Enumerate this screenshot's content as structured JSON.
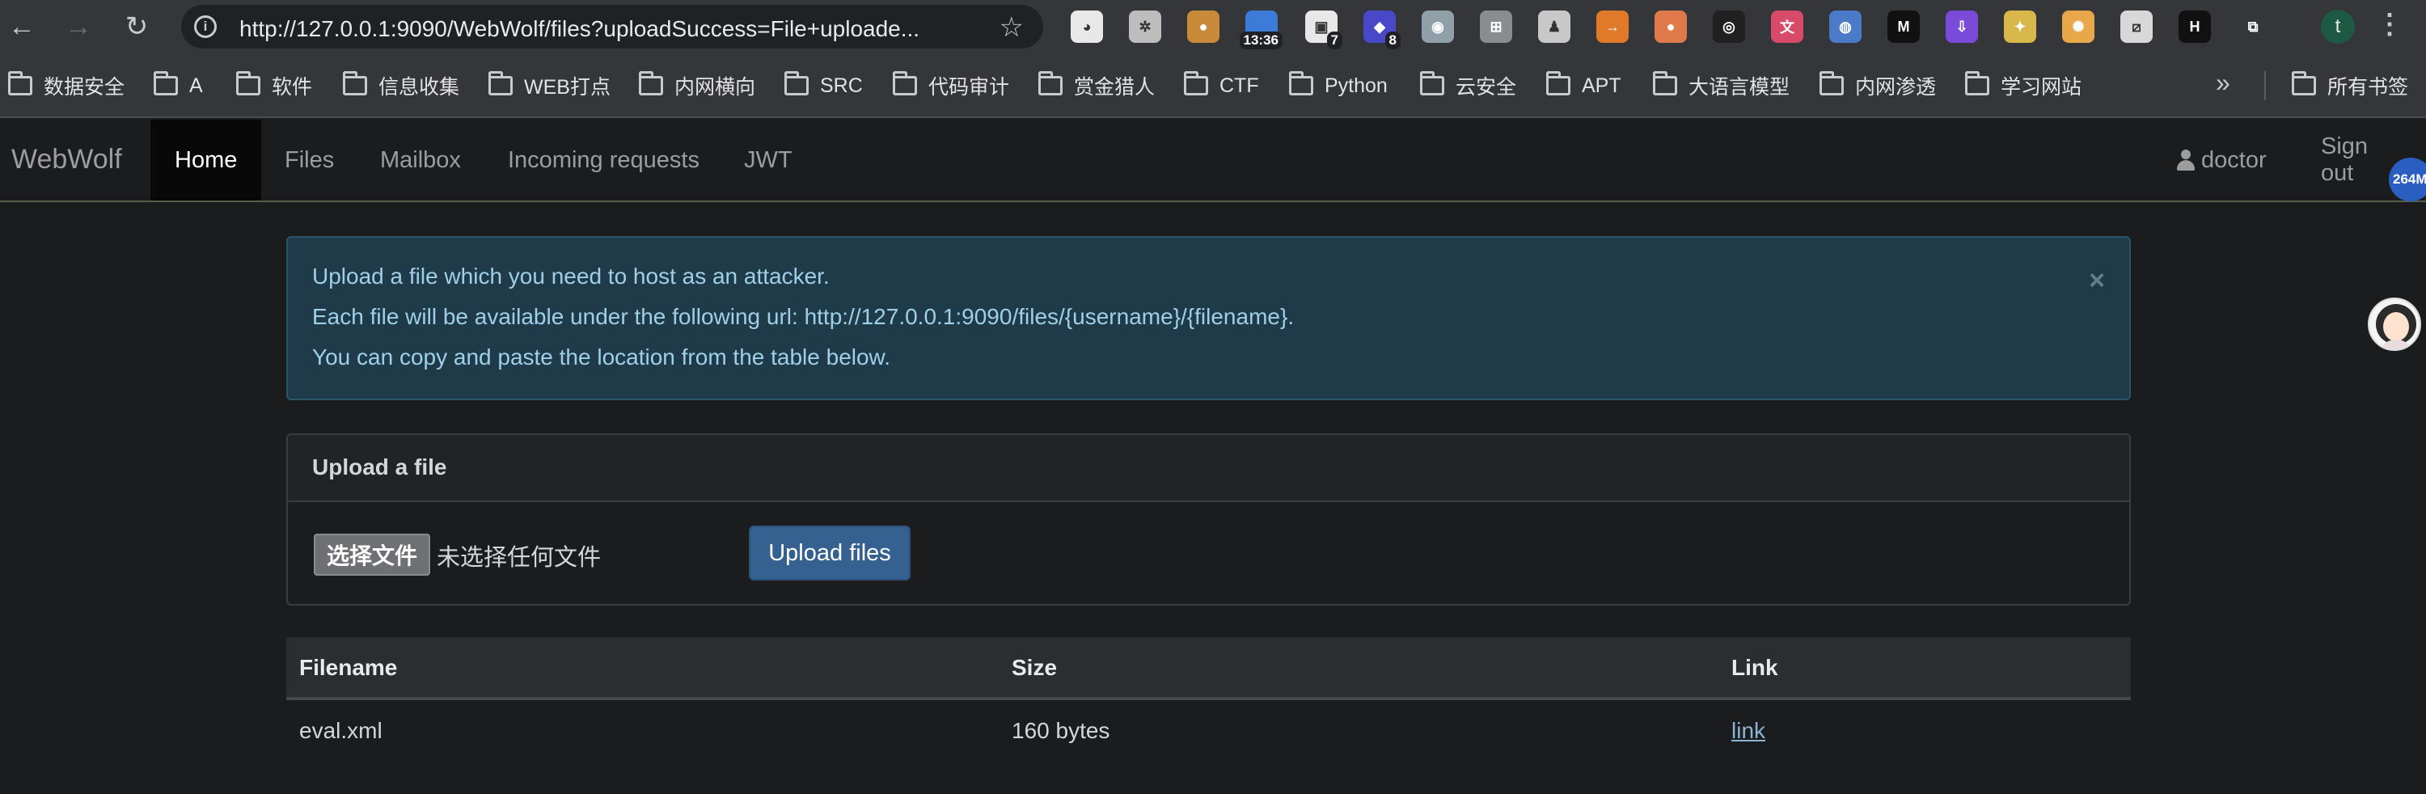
{
  "browser": {
    "url": "http://127.0.0.1:9090/WebWolf/files?uploadSuccess=File+uploade...",
    "extensions": [
      {
        "name": "ext-panda-icon",
        "color": "#e8e8e8",
        "glyph": "◕"
      },
      {
        "name": "ext-gear-icon",
        "color": "#bdbdbd",
        "glyph": "✲"
      },
      {
        "name": "ext-cookie-icon",
        "color": "#c98a3a",
        "glyph": "●"
      },
      {
        "name": "ext-clock-icon",
        "color": "#3d7bd9",
        "glyph": "",
        "badge": "13:36"
      },
      {
        "name": "ext-qr-icon",
        "color": "#e8e8e8",
        "glyph": "▣",
        "badge": "7"
      },
      {
        "name": "ext-cube-icon",
        "color": "#4848c8",
        "glyph": "◆",
        "badge": "8"
      },
      {
        "name": "ext-spy-icon",
        "color": "#8fa0a8",
        "glyph": "◉"
      },
      {
        "name": "ext-gitzip-icon",
        "color": "#8a8c90",
        "glyph": "⊞"
      },
      {
        "name": "ext-js-icon",
        "color": "#c8c8c8",
        "glyph": "♟"
      },
      {
        "name": "ext-arrow-icon",
        "color": "#e07a2a",
        "glyph": "→"
      },
      {
        "name": "ext-circle-icon",
        "color": "#e07a4a",
        "glyph": "●"
      },
      {
        "name": "ext-glasses-icon",
        "color": "#202020",
        "glyph": "◎"
      },
      {
        "name": "ext-translate-icon",
        "color": "#d84a6a",
        "glyph": "文"
      },
      {
        "name": "ext-drop-icon",
        "color": "#4a7ac8",
        "glyph": "◍"
      },
      {
        "name": "ext-medium-icon",
        "color": "#111111",
        "glyph": "M"
      },
      {
        "name": "ext-download-icon",
        "color": "#7a4ad8",
        "glyph": "⇩"
      },
      {
        "name": "ext-magic-icon",
        "color": "#d8b84a",
        "glyph": "✦"
      },
      {
        "name": "ext-settings-icon",
        "color": "#e8a84a",
        "glyph": "✺"
      },
      {
        "name": "ext-slash-icon",
        "color": "#d8d8d8",
        "glyph": "⧄"
      },
      {
        "name": "ext-h-icon",
        "color": "#111111",
        "glyph": "H"
      },
      {
        "name": "ext-puzzle-icon",
        "color": "#35363a",
        "glyph": "⧉"
      }
    ],
    "profile_initial": "t",
    "bookmarks": [
      "数据安全",
      "A",
      "软件",
      "信息收集",
      "WEB打点",
      "内网横向",
      "SRC",
      "代码审计",
      "赏金猎人",
      "CTF",
      "Python",
      "云安全",
      "APT",
      "大语言模型",
      "内网渗透",
      "学习网站"
    ],
    "bookmarks_right": "所有书签",
    "memory_badge": "264M"
  },
  "navbar": {
    "brand": "WebWolf",
    "items": [
      "Home",
      "Files",
      "Mailbox",
      "Incoming requests",
      "JWT"
    ],
    "active": "Home",
    "user": "doctor",
    "signout": "Sign out"
  },
  "alert": {
    "lines": [
      "Upload a file which you need to host as an attacker.",
      "Each file will be available under the following url: http://127.0.0.1:9090/files/{username}/{filename}.",
      "You can copy and paste the location from the table below."
    ],
    "close": "×"
  },
  "upload": {
    "title": "Upload a file",
    "choose_label": "选择文件",
    "no_file_label": "未选择任何文件",
    "button_label": "Upload files"
  },
  "files_table": {
    "headers": [
      "Filename",
      "Size",
      "Link"
    ],
    "rows": [
      {
        "filename": "eval.xml",
        "size": "160 bytes",
        "link": "link"
      }
    ]
  }
}
